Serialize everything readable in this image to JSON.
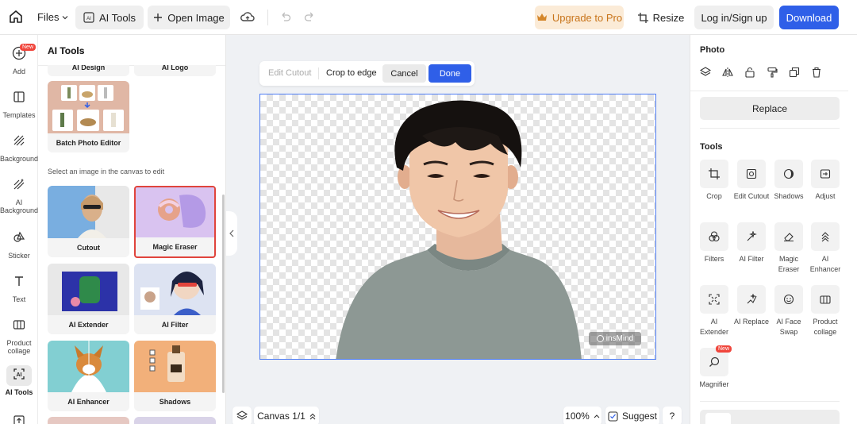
{
  "topbar": {
    "files_label": "Files",
    "ai_tools_label": "AI Tools",
    "open_image_label": "Open Image",
    "upgrade_label": "Upgrade to Pro",
    "resize_label": "Resize",
    "login_label": "Log in/Sign up",
    "download_label": "Download"
  },
  "rail": {
    "items": [
      {
        "label": "Add",
        "icon": "plus-circle-icon",
        "badge": "New"
      },
      {
        "label": "Templates",
        "icon": "templates-icon"
      },
      {
        "label": "Background",
        "icon": "background-icon"
      },
      {
        "label": "AI Background",
        "icon": "ai-background-icon"
      },
      {
        "label": "Sticker",
        "icon": "sticker-icon"
      },
      {
        "label": "Text",
        "icon": "text-icon"
      },
      {
        "label": "Product collage",
        "icon": "product-collage-icon"
      },
      {
        "label": "AI Tools",
        "icon": "ai-tools-icon"
      }
    ]
  },
  "panel": {
    "title": "AI Tools",
    "top_cards": [
      "AI Design",
      "AI Logo"
    ],
    "batch_label": "Batch Photo Editor",
    "hint": "Select an image in the canvas to edit",
    "cards": [
      "Cutout",
      "Magic Eraser",
      "AI Extender",
      "AI Filter",
      "AI Enhancer",
      "Shadows"
    ]
  },
  "cut_toolbar": {
    "edit_cutout": "Edit Cutout",
    "crop_to_edge": "Crop to edge",
    "cancel": "Cancel",
    "done": "Done"
  },
  "canvas": {
    "watermark": "insMind",
    "canvas_label": "Canvas 1/1",
    "zoom": "100%",
    "suggest": "Suggest",
    "help": "?"
  },
  "right": {
    "photo_title": "Photo",
    "replace_label": "Replace",
    "tools_title": "Tools",
    "tools": [
      {
        "label": "Crop",
        "icon": "crop-icon"
      },
      {
        "label": "Edit Cutout",
        "icon": "edit-cutout-icon"
      },
      {
        "label": "Shadows",
        "icon": "shadows-icon"
      },
      {
        "label": "Adjust",
        "icon": "adjust-icon"
      },
      {
        "label": "Filters",
        "icon": "filters-icon"
      },
      {
        "label": "AI Filter",
        "icon": "ai-filter-icon"
      },
      {
        "label": "Magic Eraser",
        "icon": "eraser-icon"
      },
      {
        "label": "AI Enhancer",
        "icon": "enhancer-icon"
      },
      {
        "label": "AI Extender",
        "icon": "extender-icon"
      },
      {
        "label": "AI Replace",
        "icon": "replace-icon"
      },
      {
        "label": "AI Face Swap",
        "icon": "face-swap-icon"
      },
      {
        "label": "Product collage",
        "icon": "collage-icon"
      },
      {
        "label": "Magnifier",
        "icon": "magnifier-icon",
        "badge": "New"
      }
    ]
  },
  "colors": {
    "accent": "#2f5fe8",
    "upgrade": "#c8741a",
    "selected_border": "#e0443c"
  }
}
